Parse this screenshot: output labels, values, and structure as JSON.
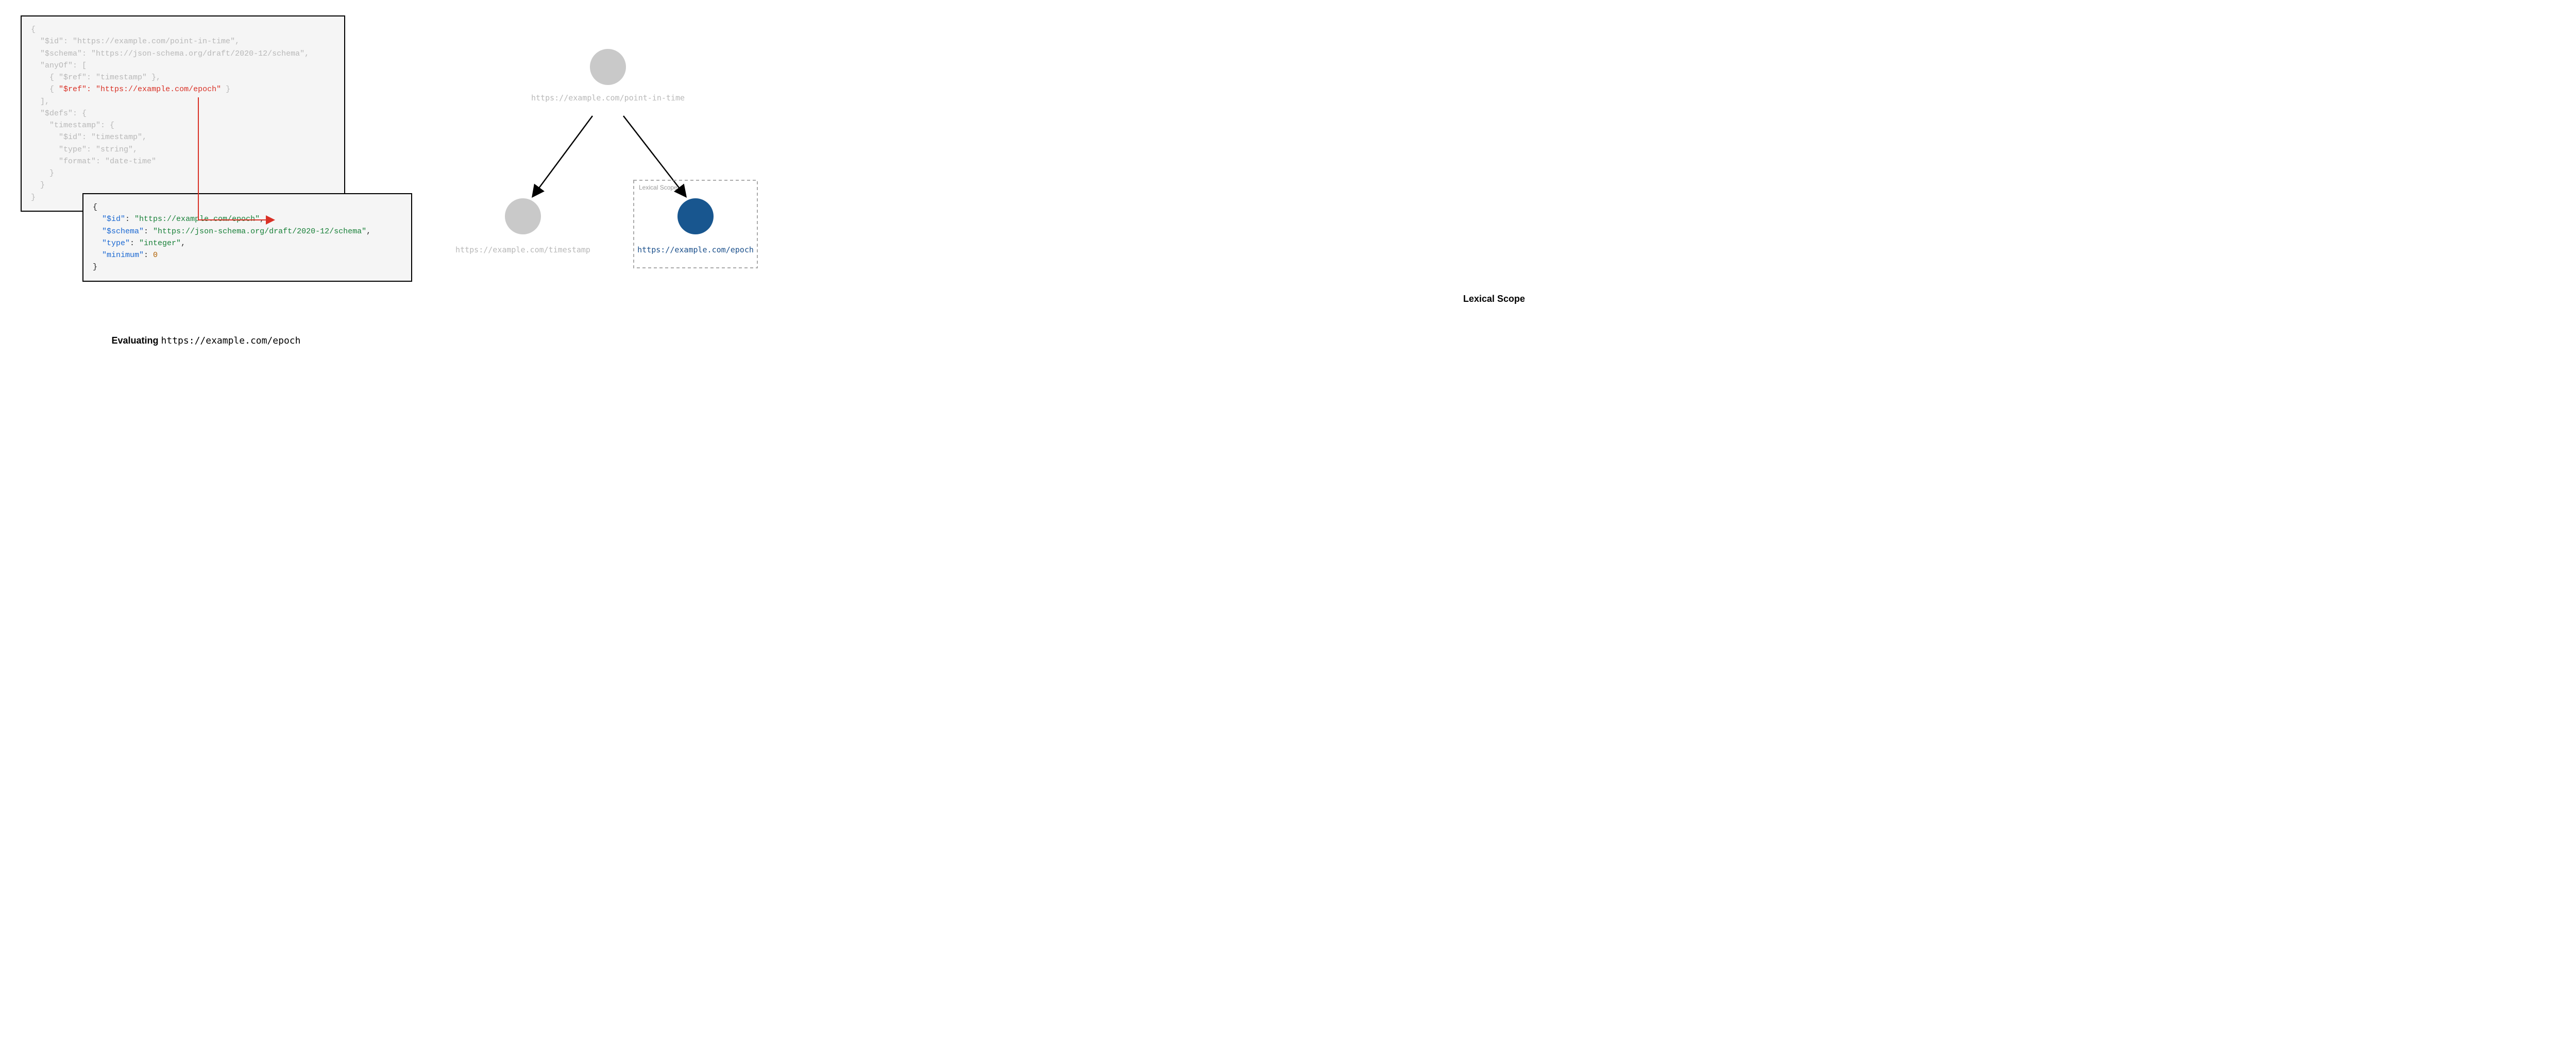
{
  "left": {
    "main_code": {
      "l1": "{",
      "l2": "  \"$id\": \"https://example.com/point-in-time\",",
      "l3": "  \"$schema\": \"https://json-schema.org/draft/2020-12/schema\",",
      "l4": "  \"anyOf\": [",
      "l5": "    { \"$ref\": \"timestamp\" },",
      "l6a": "    { ",
      "l6b_key": "\"$ref\"",
      "l6b_colon": ": ",
      "l6b_val": "\"https://example.com/epoch\"",
      "l6c": " }",
      "l7": "  ],",
      "l8": "  \"$defs\": {",
      "l9": "    \"timestamp\": {",
      "l10": "      \"$id\": \"timestamp\",",
      "l11": "      \"type\": \"string\",",
      "l12": "      \"format\": \"date-time\"",
      "l13": "    }",
      "l14": "  }",
      "l15": "}"
    },
    "sub_code": {
      "l1": "{",
      "l2_k": "\"$id\"",
      "l2_v": "\"https://example.com/epoch\"",
      "l3_k": "\"$schema\"",
      "l3_v": "\"https://json-schema.org/draft/2020-12/schema\"",
      "l4_k": "\"type\"",
      "l4_v": "\"integer\"",
      "l5_k": "\"minimum\"",
      "l5_v": "0",
      "l6": "}"
    },
    "caption_bold": "Evaluating ",
    "caption_mono": "https://example.com/epoch"
  },
  "right": {
    "root_label": "https://example.com/point-in-time",
    "left_child_label": "https://example.com/timestamp",
    "right_child_label": "https://example.com/epoch",
    "scope_box_label": "Lexical Scope",
    "caption": "Lexical Scope"
  }
}
